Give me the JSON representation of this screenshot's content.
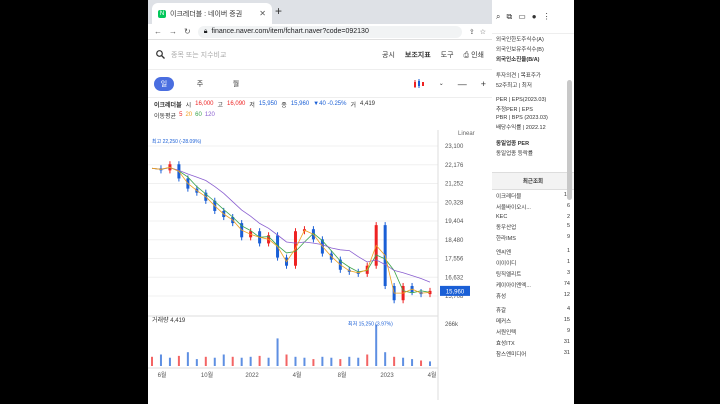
{
  "browser": {
    "tab_title": "이크레더블 : 네이버 증권",
    "favicon": "N",
    "url": "finance.naver.com/item/fchart.naver?code=092130"
  },
  "toolbar": {
    "search_placeholder": "종목 또는 지수비교",
    "links": [
      "공시",
      "보조지표",
      "도구",
      "인쇄"
    ]
  },
  "periods": [
    "일",
    "주",
    "월"
  ],
  "info": {
    "name": "이크레더블",
    "open_label": "시",
    "open": "16,000",
    "high_label": "고",
    "high": "16,090",
    "low_label": "저",
    "low": "15,950",
    "close_label": "종",
    "close": "15,960",
    "change": "▼40 -0.25%",
    "volume_label": "거",
    "volume": "4,419"
  },
  "ma": {
    "label": "이동평균",
    "periods": [
      "5",
      "20",
      "60",
      "120"
    ]
  },
  "chart_data": {
    "type": "line",
    "scale": "Linear",
    "y_ticks": [
      "23,100",
      "22,176",
      "21,252",
      "20,328",
      "19,404",
      "18,480",
      "17,556",
      "16,632",
      "15,708"
    ],
    "x_ticks": [
      "6월",
      "10월",
      "2022",
      "4월",
      "8월",
      "2023",
      "4월"
    ],
    "high_marker": "최고 22,250 (-28.09%)",
    "low_marker": "최저 15,250 (3.97%)",
    "last_price": "15,960",
    "volume_label": "거래량 4,419",
    "volume_tick": "266k",
    "series": [
      {
        "values": [
          22000,
          21900,
          22200,
          21500,
          21000,
          20800,
          20400,
          19900,
          19600,
          19300,
          18600,
          18900,
          18300,
          18700,
          17600,
          17200,
          18900,
          19000,
          18500,
          17800,
          17500,
          17000,
          16900,
          16800,
          17200,
          19200,
          16200,
          15500,
          16200,
          15900,
          15800,
          15960
        ]
      }
    ],
    "volume": [
      20,
      25,
      18,
      22,
      30,
      15,
      20,
      18,
      25,
      20,
      18,
      20,
      22,
      18,
      60,
      25,
      20,
      18,
      15,
      20,
      18,
      15,
      20,
      18,
      25,
      90,
      30,
      20,
      18,
      15,
      12,
      10
    ]
  },
  "right_panel": {
    "top_icons": [
      "tab-search",
      "puzzle",
      "reading-list",
      "profile",
      "menu"
    ],
    "lines": [
      "외국인한도주식수(A)",
      "외국인보유주식수(B)",
      "외국인소진율(B/A)"
    ],
    "lines2": [
      "투자의견 | 목표주가",
      "52주최고 | 최저"
    ],
    "lines3": [
      "PER | EPS(2023.03)",
      "추정PER | EPS",
      "PBR | BPS (2023.03)",
      "배당수익률 | 2022.12"
    ],
    "lines4": [
      "동일업종 PER",
      "동일업종 등락률"
    ],
    "recent_title": "최근조회",
    "recent_items": [
      {
        "name": "이크레더블",
        "num": "15"
      },
      {
        "name": "서울바이오시...",
        "num": "6"
      },
      {
        "name": "KEC",
        "num": "2"
      },
      {
        "name": "동우산업",
        "num": "5"
      },
      {
        "name": "한라IMS",
        "num": "9"
      },
      {
        "name": "",
        "num": ""
      },
      {
        "name": "엔씨엔",
        "num": "1"
      },
      {
        "name": "이이이디",
        "num": "1"
      },
      {
        "name": "팅직엘리트",
        "num": "3"
      },
      {
        "name": "케이아이엔엑...",
        "num": "74"
      },
      {
        "name": "휴성",
        "num": "12"
      },
      {
        "name": "",
        "num": ""
      },
      {
        "name": "휴갈",
        "num": "4"
      },
      {
        "name": "메커스",
        "num": "15"
      },
      {
        "name": "서원인텍",
        "num": "9"
      },
      {
        "name": "효성ITX",
        "num": "31"
      },
      {
        "name": "참스엔미디어",
        "num": "31"
      }
    ]
  }
}
